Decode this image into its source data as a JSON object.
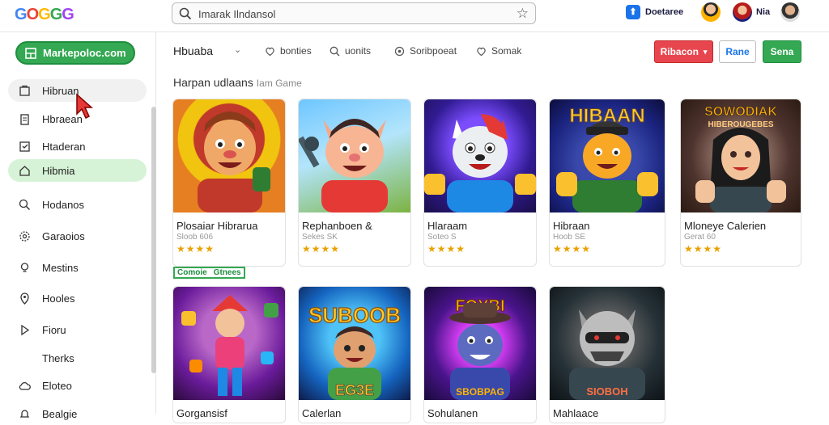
{
  "app": {
    "logo_letters": [
      "G",
      "O",
      "G",
      "G",
      "G"
    ],
    "search_value": "Imarak Ilndansol",
    "developer_label": "Doetaree",
    "user_label": "Nia"
  },
  "sidebar": {
    "primary_button": "Markepoloc.com",
    "items": [
      {
        "label": "Hibruan",
        "icon": "box-icon",
        "state": "hover"
      },
      {
        "label": "Hbraean",
        "icon": "clipboard-icon",
        "state": ""
      },
      {
        "label": "Htaderan",
        "icon": "checklist-icon",
        "state": ""
      },
      {
        "label": "Hibmia",
        "icon": "house-icon",
        "state": "active"
      },
      {
        "label": "Hodanos",
        "icon": "search-icon",
        "state": ""
      },
      {
        "label": "Garaoios",
        "icon": "gear-icon",
        "state": ""
      },
      {
        "label": "Mestins",
        "icon": "lightbulb-icon",
        "state": ""
      },
      {
        "label": "Hooles",
        "icon": "location-icon",
        "state": ""
      },
      {
        "label": "Fioru",
        "icon": "play-icon",
        "state": ""
      },
      {
        "label": "Therks",
        "icon": "",
        "state": ""
      },
      {
        "label": "Eloteo",
        "icon": "cloud-icon",
        "state": ""
      },
      {
        "label": "Bealgie",
        "icon": "bell-icon",
        "state": ""
      }
    ]
  },
  "toolbar": {
    "title": "Hbuaba",
    "tabs": [
      {
        "label": "bonties",
        "icon": "heart-icon"
      },
      {
        "label": "uonits",
        "icon": "search-icon"
      },
      {
        "label": "Soribpoeat",
        "icon": "settings-icon"
      },
      {
        "label": "Somak",
        "icon": "heart-icon"
      }
    ],
    "red_button": "Ribacon",
    "outline_button": "Rane",
    "green_button": "Sena"
  },
  "section_title": "Harpan udlaans",
  "section_suffix": "Iam Game",
  "cards_row1": [
    {
      "title": "Plosaiar Hibrarua",
      "sub": "Sloob 606",
      "stars": "★★★★"
    },
    {
      "title": "Rephanboen &",
      "sub": "Sekes SK",
      "stars": "★★★★"
    },
    {
      "title": "Hlaraam",
      "sub": "Soteo S",
      "stars": "★★★★"
    },
    {
      "title": "Hibraan",
      "sub": "Hoob SE",
      "stars": "★★★★"
    },
    {
      "title": "Mloneye Calerien",
      "sub": "Gerat 60",
      "stars": "★★★★"
    }
  ],
  "cards_row2": [
    {
      "title": "Gorgansisf"
    },
    {
      "title": "Calerlan"
    },
    {
      "title": "Sohulanen"
    },
    {
      "title": "Mahlaace"
    }
  ],
  "tag": {
    "a": "Comoie",
    "b": "Gtnees"
  },
  "colors": {
    "accent_green": "#34a853",
    "red_button": "#e8464f",
    "blue_link": "#1a73e8"
  }
}
